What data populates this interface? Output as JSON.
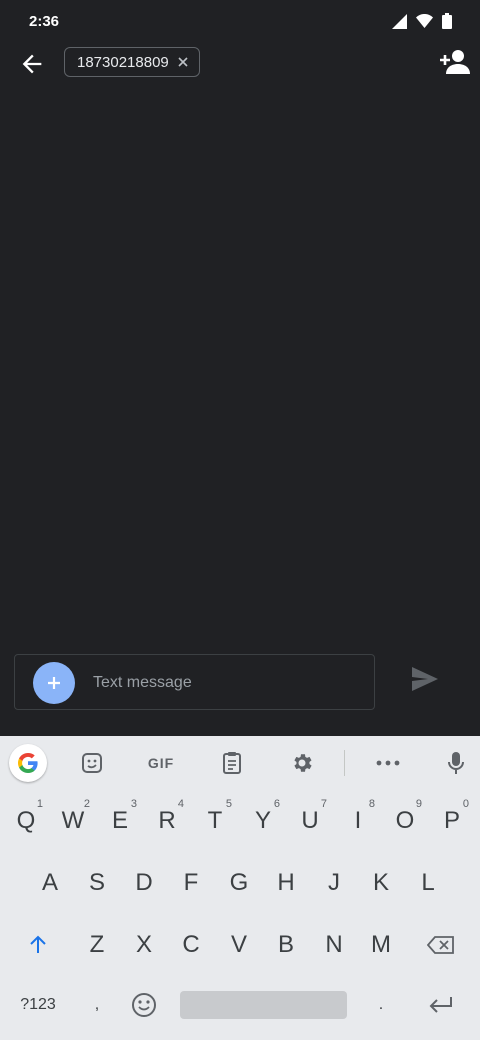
{
  "status_bar": {
    "time": "2:36"
  },
  "app_bar": {
    "recipient_chip": "18730218809"
  },
  "compose": {
    "placeholder": "Text message"
  },
  "keyboard": {
    "toolbar": {
      "gif_label": "GIF"
    },
    "row1": [
      {
        "key": "Q",
        "hint": "1"
      },
      {
        "key": "W",
        "hint": "2"
      },
      {
        "key": "E",
        "hint": "3"
      },
      {
        "key": "R",
        "hint": "4"
      },
      {
        "key": "T",
        "hint": "5"
      },
      {
        "key": "Y",
        "hint": "6"
      },
      {
        "key": "U",
        "hint": "7"
      },
      {
        "key": "I",
        "hint": "8"
      },
      {
        "key": "O",
        "hint": "9"
      },
      {
        "key": "P",
        "hint": "0"
      }
    ],
    "row2": [
      "A",
      "S",
      "D",
      "F",
      "G",
      "H",
      "J",
      "K",
      "L"
    ],
    "row3": [
      "Z",
      "X",
      "C",
      "V",
      "B",
      "N",
      "M"
    ],
    "row4": {
      "symbols": "?123",
      "comma": ",",
      "period": "."
    }
  },
  "colors": {
    "background": "#202124",
    "accent": "#8ab4f8",
    "keyboard": "#e8eaed"
  }
}
